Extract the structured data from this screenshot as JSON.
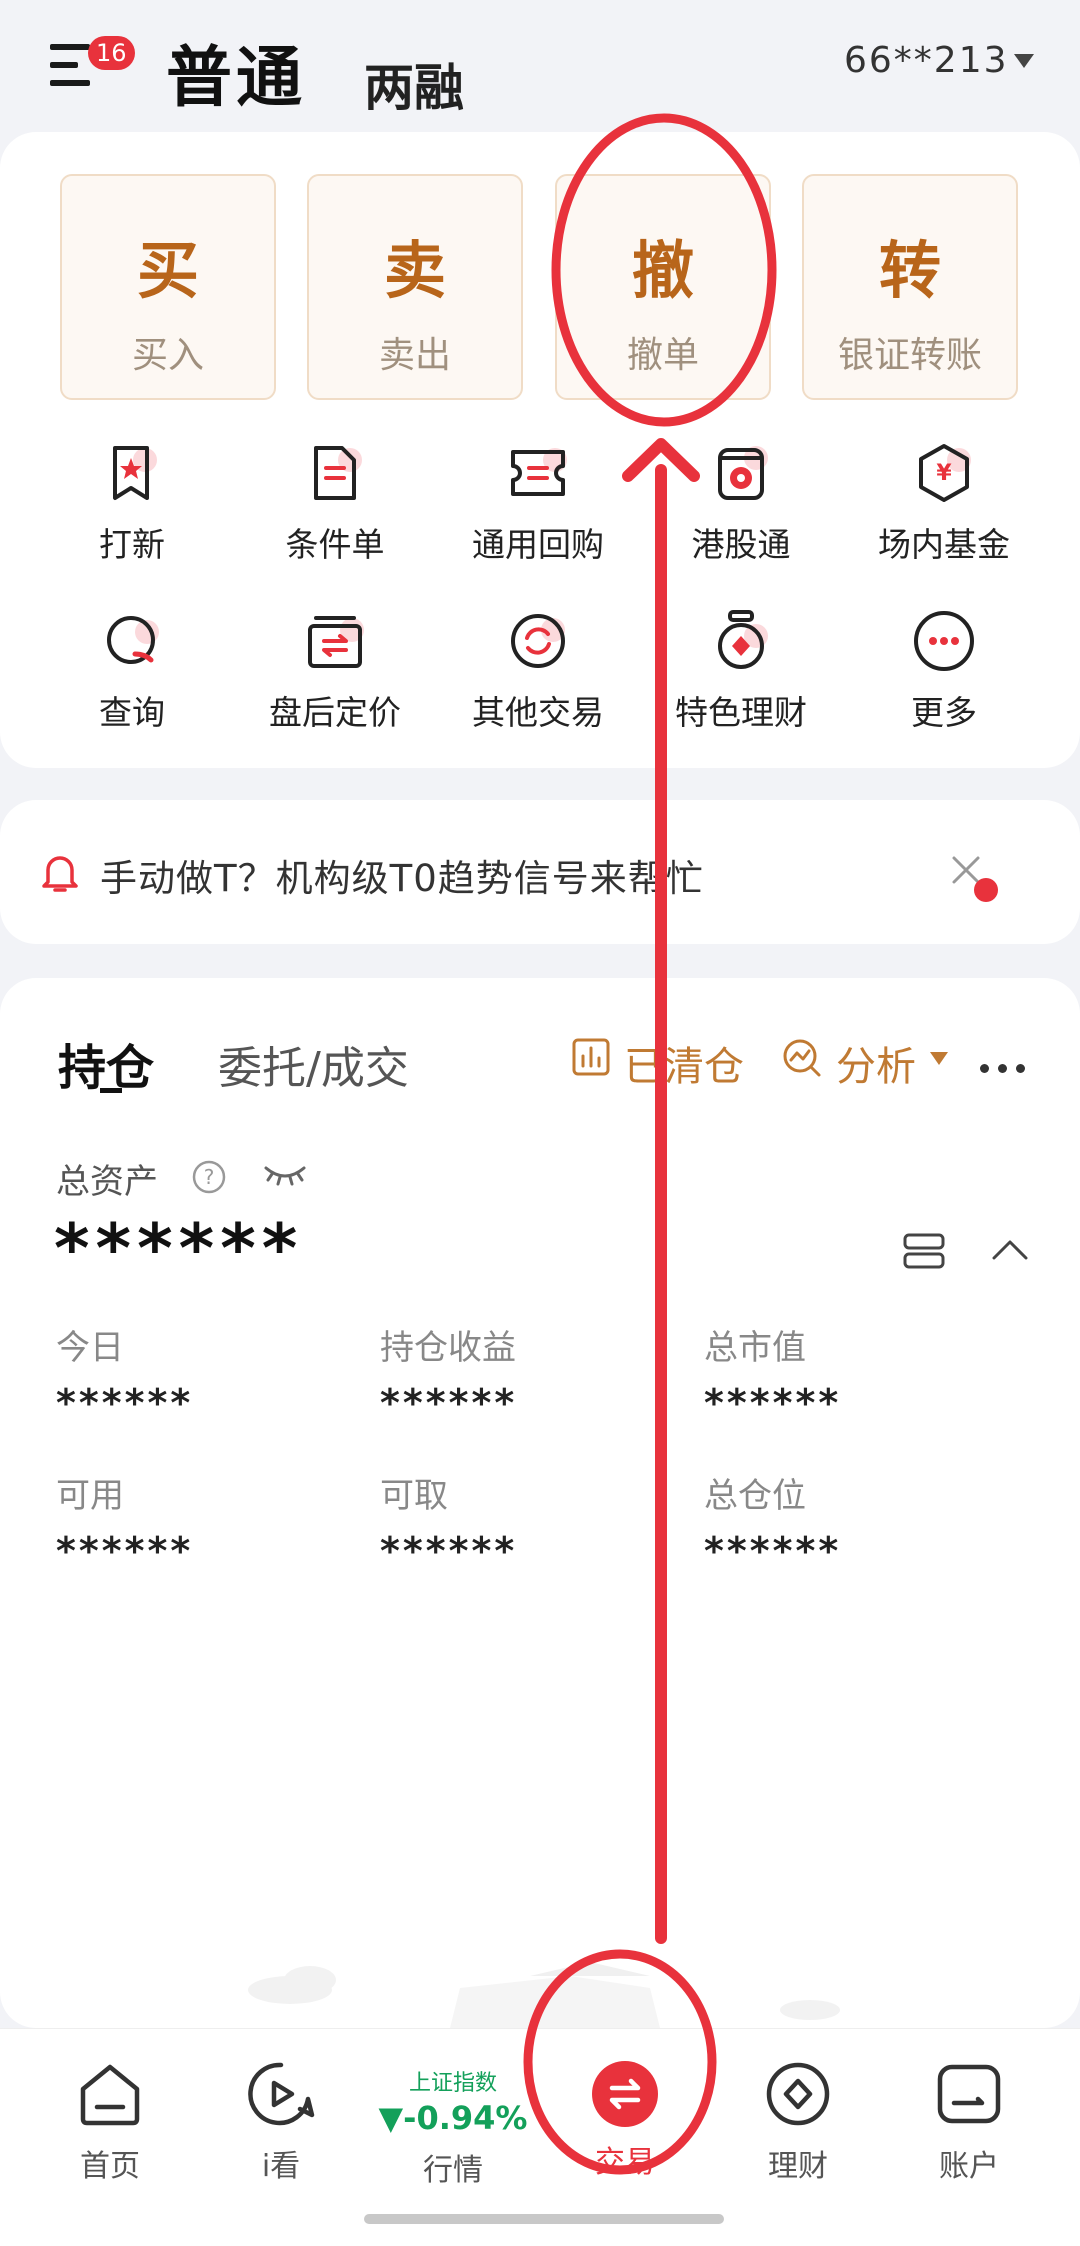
{
  "header": {
    "menu_badge": "16",
    "tab_normal": "普通",
    "tab_margin": "两融",
    "account": "66**213"
  },
  "quick_actions": [
    {
      "big": "买",
      "small": "买入"
    },
    {
      "big": "卖",
      "small": "卖出"
    },
    {
      "big": "撤",
      "small": "撤单"
    },
    {
      "big": "转",
      "small": "银证转账"
    }
  ],
  "grid_row1": [
    {
      "label": "打新",
      "icon": "ipo-icon"
    },
    {
      "label": "条件单",
      "icon": "conditional-order-icon"
    },
    {
      "label": "通用回购",
      "icon": "repo-icon"
    },
    {
      "label": "港股通",
      "icon": "hk-connect-icon"
    },
    {
      "label": "场内基金",
      "icon": "fund-icon"
    }
  ],
  "grid_row2": [
    {
      "label": "查询",
      "icon": "query-icon"
    },
    {
      "label": "盘后定价",
      "icon": "after-hours-icon"
    },
    {
      "label": "其他交易",
      "icon": "other-trade-icon"
    },
    {
      "label": "特色理财",
      "icon": "wealth-icon"
    },
    {
      "label": "更多",
      "icon": "more-icon"
    }
  ],
  "notice": {
    "text": "手动做T？机构级T0趋势信号来帮忙"
  },
  "positions": {
    "tab_positions": "持仓",
    "tab_orders": "委托/成交",
    "cleared": "已清仓",
    "analysis": "分析",
    "total_assets_label": "总资产",
    "total_assets_value": "******",
    "metrics": [
      {
        "label": "今日",
        "value": "******"
      },
      {
        "label": "持仓收益",
        "value": "******"
      },
      {
        "label": "总市值",
        "value": "******"
      },
      {
        "label": "可用",
        "value": "******"
      },
      {
        "label": "可取",
        "value": "******"
      },
      {
        "label": "总仓位",
        "value": "******"
      }
    ]
  },
  "tabbar": {
    "home": "首页",
    "watch": "i看",
    "market": "行情",
    "index_name": "上证指数",
    "index_change": "▼-0.94%",
    "trade": "交易",
    "wealth": "理财",
    "account": "账户"
  },
  "colors": {
    "accent_red": "#e8323c",
    "gold": "#b8651a",
    "index_down_green": "#13a05a"
  }
}
